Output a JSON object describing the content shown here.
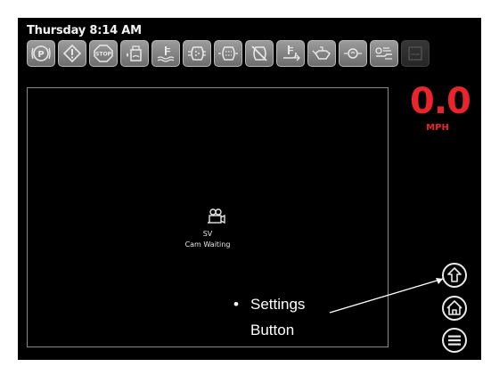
{
  "status_bar": {
    "clock": "Thursday 8:14 AM",
    "indicators": [
      {
        "icon": "parking-brake-icon",
        "dim": false
      },
      {
        "icon": "warning-icon",
        "dim": false
      },
      {
        "icon": "stop-icon",
        "label": "STOP",
        "dim": false
      },
      {
        "icon": "fuel-water-icon",
        "dim": false
      },
      {
        "icon": "coolant-temp-icon",
        "dim": false
      },
      {
        "icon": "dpf-icon",
        "dim": false
      },
      {
        "icon": "dpf-regen-icon",
        "dim": false
      },
      {
        "icon": "regen-inhibit-icon",
        "dim": false
      },
      {
        "icon": "exhaust-temp-icon",
        "dim": false
      },
      {
        "icon": "oil-pressure-icon",
        "dim": false
      },
      {
        "icon": "glow-plug-icon",
        "dim": false
      },
      {
        "icon": "transmission-icon",
        "dim": false
      },
      {
        "icon": "def-level-icon",
        "dim": true
      }
    ]
  },
  "camera": {
    "icon": "camera-icon",
    "label": "SV",
    "status": "Cam Waiting"
  },
  "speed": {
    "value": "0.0",
    "unit": "MPH",
    "color": "#e8242c"
  },
  "side_buttons": [
    {
      "name": "settings-button",
      "icon": "up-arrow-icon"
    },
    {
      "name": "home-button",
      "icon": "home-icon"
    },
    {
      "name": "menu-button",
      "icon": "menu-icon"
    }
  ],
  "callout": {
    "bullet": "•",
    "line1": "Settings",
    "line2": "Button"
  }
}
